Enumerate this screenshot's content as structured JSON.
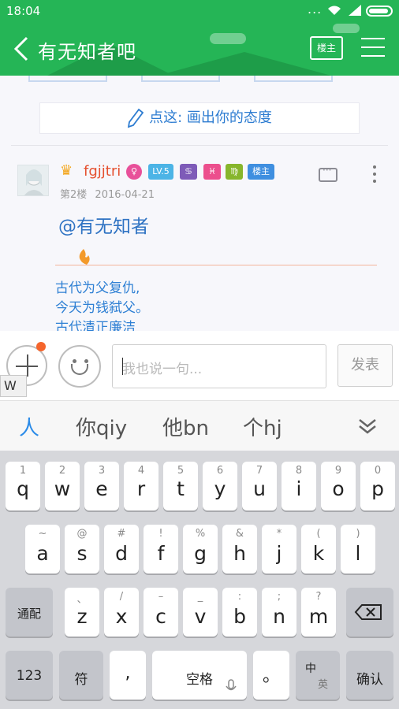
{
  "status_bar": {
    "time": "18:04",
    "dots": "...",
    "wifi_icon": "wifi-icon",
    "signal_icon": "signal-icon",
    "battery_icon": "battery-icon"
  },
  "header": {
    "title": "有无知者吧",
    "owner_button": "楼主",
    "back_icon": "chevron-left-icon",
    "menu_icon": "hamburger-icon",
    "bg_color": "#25b556"
  },
  "attitude_prompt": "点这: 画出你的态度",
  "post": {
    "username": "fgjjtri",
    "badges": [
      {
        "text": "♀",
        "color": "#e8509a"
      },
      {
        "text": "LV.5",
        "color": "#4cb4e6"
      },
      {
        "text": "♋",
        "color": "#7e5bb8"
      },
      {
        "text": "♓",
        "color": "#ec4f8d"
      },
      {
        "text": "♍",
        "color": "#87b62c"
      },
      {
        "text": "楼主",
        "color": "#3f8fe0"
      }
    ],
    "floor": "第2楼",
    "date": "2016-04-21",
    "mention": "@有无知者",
    "lines": [
      "古代为父复仇,",
      "今天为钱弑父。",
      "古代清正廉洁"
    ]
  },
  "input_bar": {
    "placeholder": "我也说一句...",
    "send_label": "发表",
    "floating_key": "W"
  },
  "candidates": [
    "人",
    "你qiy",
    "他bn",
    "个hj"
  ],
  "keyboard": {
    "row1": [
      [
        "1",
        "q"
      ],
      [
        "2",
        "w"
      ],
      [
        "3",
        "e"
      ],
      [
        "4",
        "r"
      ],
      [
        "5",
        "t"
      ],
      [
        "6",
        "y"
      ],
      [
        "7",
        "u"
      ],
      [
        "8",
        "i"
      ],
      [
        "9",
        "o"
      ],
      [
        "0",
        "p"
      ]
    ],
    "row2": [
      [
        "~",
        "a"
      ],
      [
        "@",
        "s"
      ],
      [
        "#",
        "d"
      ],
      [
        "!",
        "f"
      ],
      [
        "%",
        "g"
      ],
      [
        "&",
        "h"
      ],
      [
        "*",
        "j"
      ],
      [
        "(",
        "k"
      ],
      [
        ")",
        "l"
      ]
    ],
    "row3": [
      [
        "、",
        "z"
      ],
      [
        "/",
        "x"
      ],
      [
        "–",
        "c"
      ],
      [
        "_",
        "v"
      ],
      [
        ":",
        "b"
      ],
      [
        ";",
        "n"
      ],
      [
        "?",
        "m"
      ]
    ],
    "shift_label": "通配",
    "num_label": "123",
    "symbol_label": "符",
    "comma_label": ",",
    "space_label": "空格",
    "period_label": "。",
    "lang_top": "中",
    "lang_bottom": "英",
    "enter_label": "确认"
  }
}
